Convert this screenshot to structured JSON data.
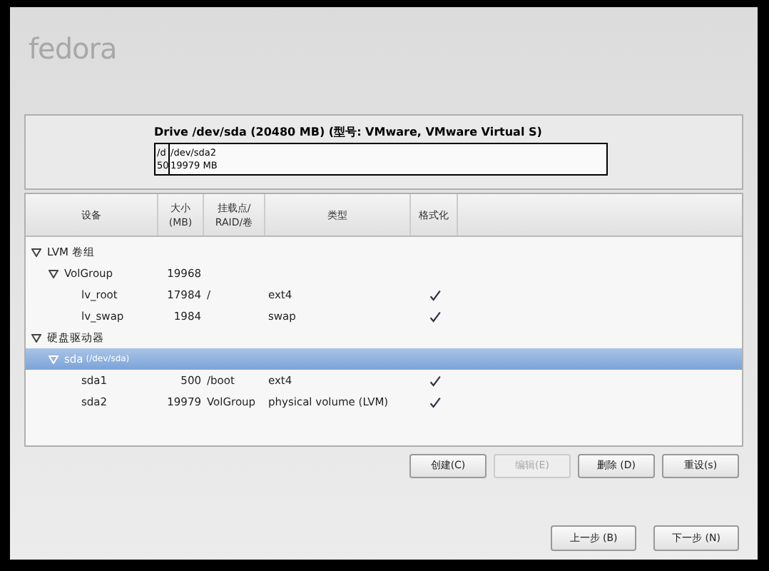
{
  "logo": "fedora",
  "drive": {
    "title": "Drive /dev/sda (20480 MB) (型号: VMware, VMware Virtual S)",
    "segments": [
      {
        "lines": [
          "/d",
          "50"
        ],
        "level": 0.024,
        "selected": false
      },
      {
        "lines": [
          "/dev/sda2",
          "19979 MB"
        ],
        "level": 0.976,
        "selected": true
      }
    ]
  },
  "table": {
    "columns": [
      "设备",
      "大小\n(MB)",
      "挂载点/\nRAID/卷",
      "类型",
      "格式化"
    ],
    "rows": [
      {
        "device": "LVM 卷组",
        "expanded": true,
        "selected": false,
        "children": [
          {
            "device": "VolGroup",
            "size": "19968",
            "expanded": true,
            "selected": false,
            "children": [
              {
                "device": "lv_root",
                "size": "17984",
                "mount": "/",
                "type": "ext4",
                "format": true,
                "selected": false
              },
              {
                "device": "lv_swap",
                "size": "1984",
                "type": "swap",
                "format": true,
                "selected": false
              }
            ]
          }
        ]
      },
      {
        "device": "硬盘驱动器",
        "expanded": true,
        "selected": false,
        "children": [
          {
            "device": "sda",
            "note": "(/dev/sda)",
            "expanded": true,
            "selected": true,
            "children": [
              {
                "device": "sda1",
                "size": "500",
                "mount": "/boot",
                "type": "ext4",
                "format": true,
                "selected": false
              },
              {
                "device": "sda2",
                "size": "19979",
                "mount": "VolGroup",
                "type": "physical volume (LVM)",
                "format": true,
                "selected": false
              }
            ]
          }
        ]
      }
    ]
  },
  "actions": [
    {
      "label": "创建(C)",
      "disabled": false
    },
    {
      "label": "编辑(E)",
      "disabled": true
    },
    {
      "label": "删除 (D)",
      "disabled": false
    },
    {
      "label": "重设(s)",
      "disabled": false
    }
  ],
  "nav": [
    {
      "label": "上一步 (B)"
    },
    {
      "label": "下一步 (N)"
    }
  ]
}
